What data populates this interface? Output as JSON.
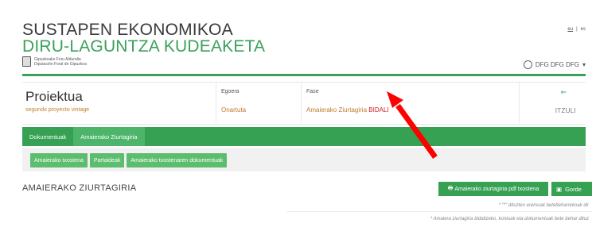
{
  "header": {
    "title_line1": "SUSTAPEN EKONOMIKOA",
    "title_line2": "DIRU-LAGUNTZA KUDEAKETA",
    "logo_line1": "Gipuzkoako Foru Aldundia",
    "logo_line2": "Diputación Foral de Gipuzkoa",
    "languages": [
      "eu",
      "es"
    ],
    "user_name": "DFG DFG DFG"
  },
  "project": {
    "title": "Proiektua",
    "subtitle": "segundo proyecto vintage",
    "status_header": "Egoera",
    "status_value": "Onartuta",
    "phase_header": "Fase",
    "phase_value": "Amaierako Ziurtagiria",
    "phase_badge": "BIDALI",
    "back_label": "ITZULI"
  },
  "tabs": [
    "Dokumentuak",
    "Amaierako Ziurtagiria"
  ],
  "subtabs": [
    "Amaierako txostena",
    "Partaideak",
    "Amaierako txostenaren dokumentuak"
  ],
  "section": {
    "title": "AMAIERAKO ZIURTAGIRIA",
    "pdf_button": "Amaierako ziurtagiria pdf txostena",
    "save_button": "Gorde",
    "note1": "* \"*\" dituzten eremuak betebeharrekoak dir",
    "note2": "* Amaiera ziurtagiria bidaltzeko, kontuak eta dokumentuak bete behar dituz"
  },
  "colors": {
    "brand_green": "#36a053",
    "accent_orange": "#c07d2a",
    "annotation_red": "#ff0000"
  }
}
